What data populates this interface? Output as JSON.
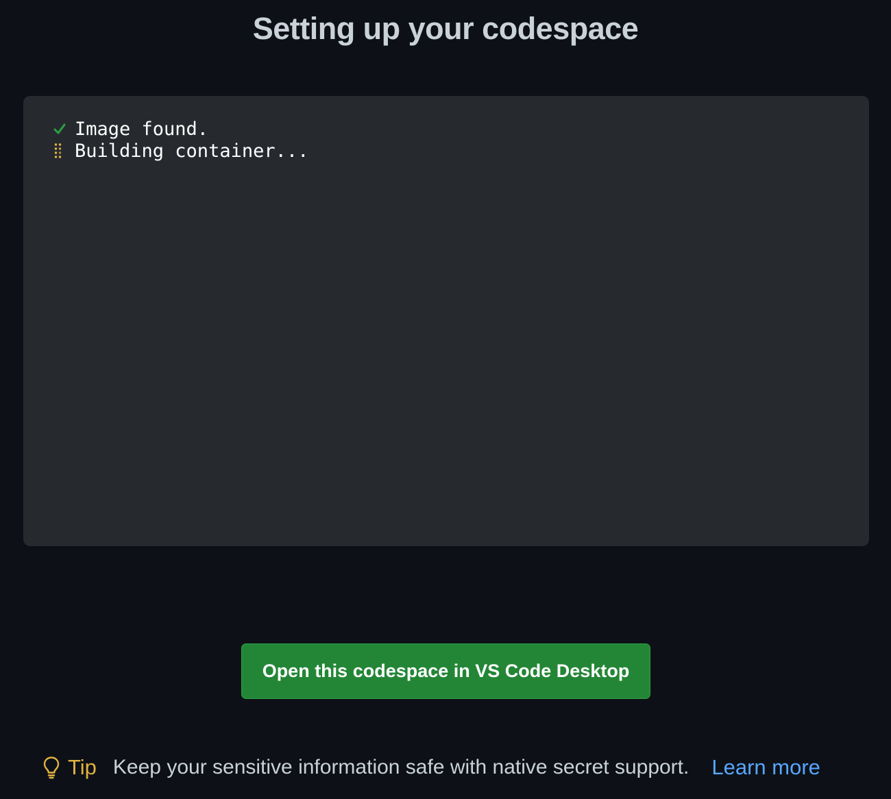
{
  "page": {
    "title": "Setting up your codespace"
  },
  "log": {
    "lines": [
      {
        "icon": "check-icon",
        "status": "done",
        "text": "Image found."
      },
      {
        "icon": "spinner-icon",
        "status": "in-progress",
        "text": "Building container..."
      }
    ]
  },
  "actions": {
    "open_desktop_label": "Open this codespace in VS Code Desktop"
  },
  "tip": {
    "icon": "lightbulb-icon",
    "label": "Tip",
    "text": "Keep your sensitive information safe with native secret support.",
    "link_label": "Learn more"
  },
  "colors": {
    "background": "#0d1117",
    "panel": "#262a2f",
    "success": "#2ea043",
    "warning": "#e3b341",
    "button": "#238636",
    "link": "#58a6ff"
  }
}
